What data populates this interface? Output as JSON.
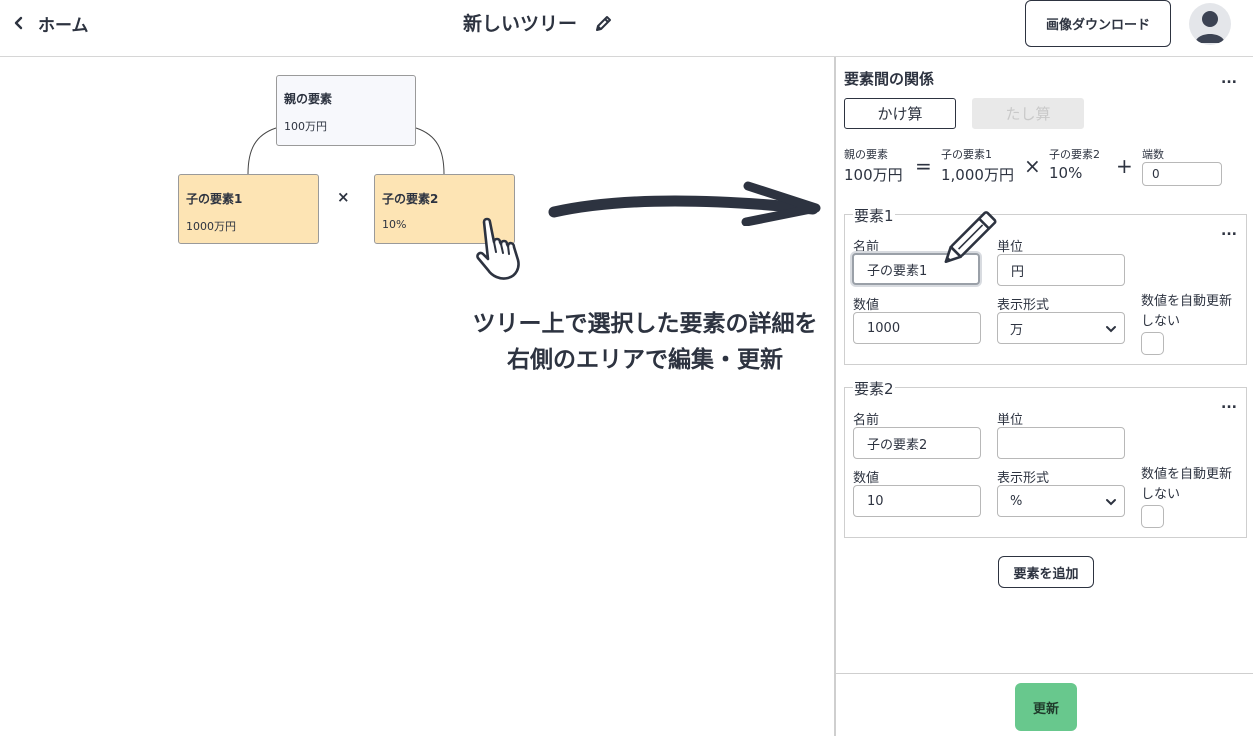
{
  "header": {
    "back_label": "ホーム",
    "title": "新しいツリー",
    "download_label": "画像ダウンロード"
  },
  "tree": {
    "parent": {
      "name": "親の要素",
      "value": "100万円"
    },
    "children": [
      {
        "name": "子の要素1",
        "value": "1000万円"
      },
      {
        "name": "子の要素2",
        "value": "10%"
      }
    ],
    "operator": "×"
  },
  "caption": {
    "line1": "ツリー上で選択した要素の詳細を",
    "line2": "右側のエリアで編集・更新"
  },
  "panel": {
    "title": "要素間の関係",
    "more": "...",
    "operations": {
      "multiply": "かけ算",
      "add": "たし算",
      "selected": "かけ算"
    },
    "formula": {
      "parent_label": "親の要素",
      "parent_value": "100万円",
      "eq": "=",
      "child1_label": "子の要素1",
      "child1_value": "1,000万円",
      "times": "×",
      "child2_label": "子の要素2",
      "child2_value": "10%",
      "plus": "+",
      "remainder_label": "端数",
      "remainder_value": "0"
    },
    "elements": [
      {
        "legend": "要素1",
        "name_label": "名前",
        "name_value": "子の要素1",
        "unit_label": "単位",
        "unit_value": "円",
        "number_label": "数値",
        "number_value": "1000",
        "format_label": "表示形式",
        "format_value": "万",
        "auto_update_label": "数値を自動更新しない",
        "auto_update_checked": false
      },
      {
        "legend": "要素2",
        "name_label": "名前",
        "name_value": "子の要素2",
        "unit_label": "単位",
        "unit_value": "",
        "number_label": "数値",
        "number_value": "10",
        "format_label": "表示形式",
        "format_value": "%",
        "auto_update_label": "数値を自動更新しない",
        "auto_update_checked": false
      }
    ],
    "add_element_label": "要素を追加",
    "update_label": "更新"
  },
  "colors": {
    "text": "#2d3340",
    "child_node": "#fde4b4",
    "parent_node": "#f7f8fc",
    "update_button": "#68c88d"
  }
}
